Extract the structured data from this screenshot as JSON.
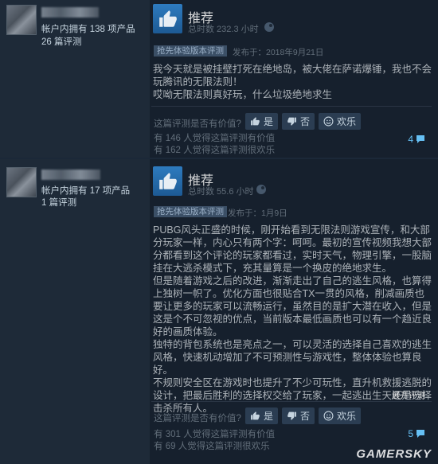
{
  "reviews": [
    {
      "user_stats": "帐户内拥有 138 项产品",
      "user_reviews": "26 篇评测",
      "recommendation": "推荐",
      "hours": "总时数 232.3 小时",
      "early_access_tag": "抢先体验版本评测",
      "posted": "发布于：2018年9月21日",
      "text": [
        "我今天就是被挂壁打死在绝地岛，被大佬在萨诺爆锤，我也不会玩腾讯的无限法则！",
        "哎呦无限法则真好玩，什么垃圾绝地求生"
      ],
      "helpful_question": "这篇评测是否有价值?",
      "yes_label": "是",
      "no_label": "否",
      "funny_label": "欢乐",
      "helpful_count": "有 146 人觉得这篇评测有价值",
      "funny_count": "有 162 人觉得这篇评测很欢乐",
      "comments": "4"
    },
    {
      "user_stats": "帐户内拥有 17 项产品",
      "user_reviews": "1 篇评测",
      "recommendation": "推荐",
      "hours": "总时数 55.6 小时",
      "early_access_tag": "抢先体验版本评测",
      "posted": "发布于：1月9日",
      "text": [
        "PUBG风头正盛的时候，刚开始看到无限法则游戏宣传，和大部分玩家一样，内心只有两个字：呵呵。最初的宣传视频我想大部分都看到这个评论的玩家都看过，实时天气，物理引擎，一股脑挂在大逃杀模式下，充其量算是一个换皮的绝地求生。",
        "但是随着游戏之后的改进，渐渐走出了自己的逃生风格，也算得上独树一帜了。优化方面也很贴合TX一贯的风格，削减画质也要让更多的玩家可以流畅运行，虽然目的是扩大潜在收入，但是这是个不可忽视的优点，当前版本最低画质也可以有一个趋近良好的画质体验。",
        "独特的背包系统也是亮点之一，可以灵活的选择自己喜欢的逃生风格，快速机动增加了不可预测性与游戏性，整体体验也算良好。",
        "不规则安全区在游戏时也提升了不少可玩性，直升机救援逃脱的设计，把最后胜利的选择权交给了玩家，一起逃出生天还是选择击杀所有人。"
      ],
      "expand": "展开评测",
      "helpful_question": "这篇评测是否有价值?",
      "yes_label": "是",
      "no_label": "否",
      "funny_label": "欢乐",
      "helpful_count": "有 301 人觉得这篇评测有价值",
      "funny_count": "有 69 人觉得这篇评测很欢乐",
      "comments": "5"
    }
  ],
  "watermark": "GAMERSKY",
  "icons": [
    "thumbs-up-icon",
    "thumbs-down-icon",
    "smile-icon",
    "steam-icon",
    "comment-icon"
  ],
  "colors": {
    "background": "#1b2838",
    "thumb_blue": "#2e7bbf",
    "link_blue": "#66c0f4"
  }
}
